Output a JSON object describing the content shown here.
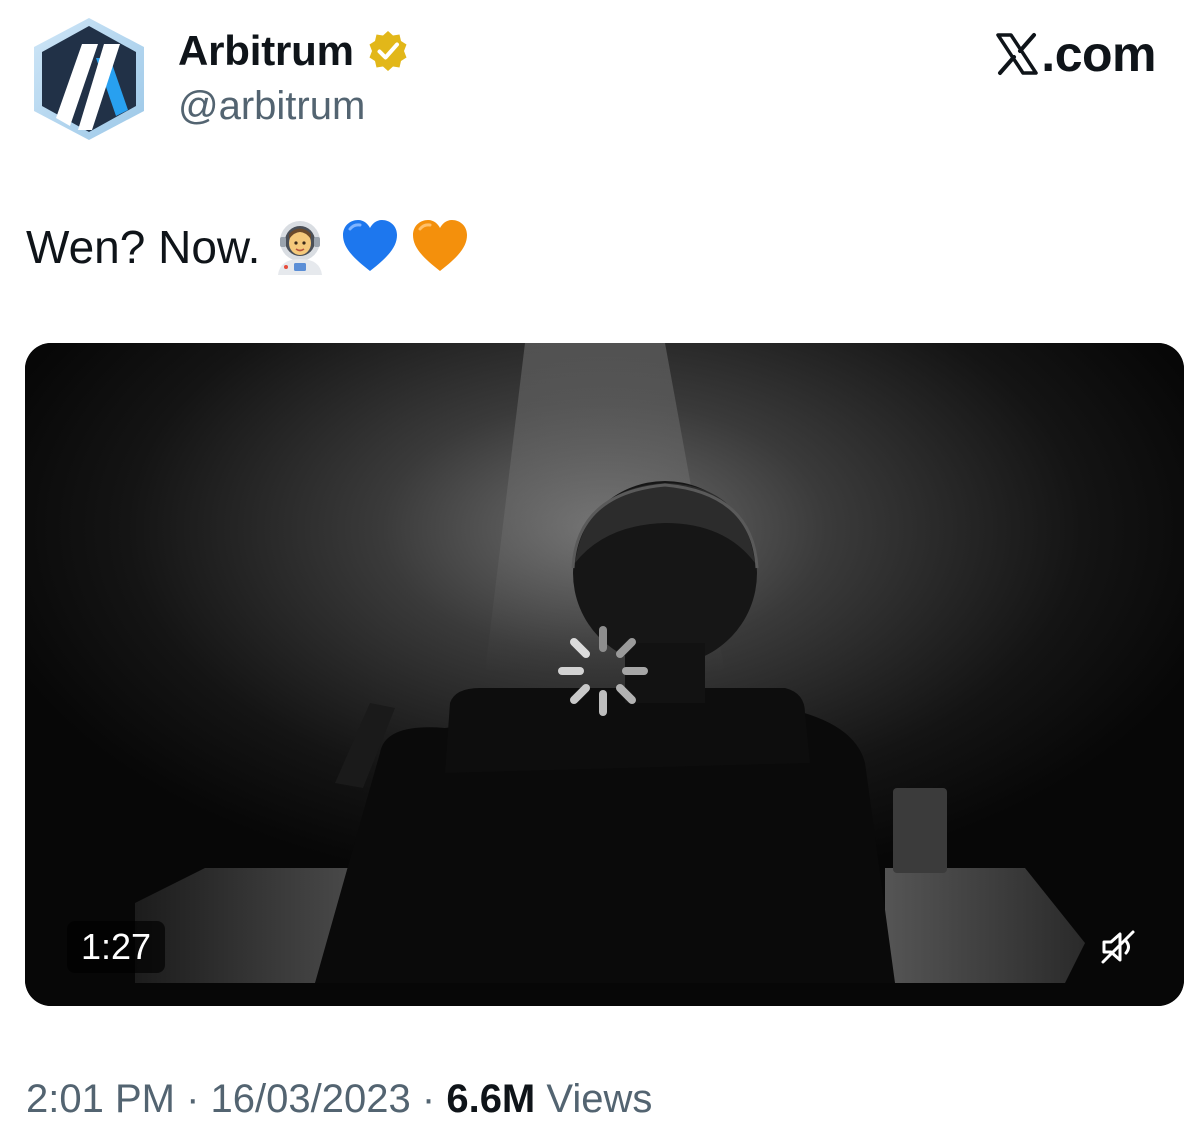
{
  "author": {
    "name": "Arbitrum",
    "handle": "@arbitrum",
    "verified": true,
    "avatar_icon": "arbitrum-logo-icon",
    "badge_icon": "verified-badge-icon"
  },
  "brand": {
    "label": ".com",
    "icon": "x-logo-icon"
  },
  "tweet": {
    "text": "Wen? Now.",
    "emojis": [
      "astronaut-emoji",
      "blue-heart-emoji",
      "orange-heart-emoji"
    ]
  },
  "video": {
    "duration": "1:27",
    "muted": true,
    "loading": true
  },
  "meta": {
    "time": "2:01 PM",
    "separator": "·",
    "date": "16/03/2023",
    "views_count": "6.6M",
    "views_label": "Views"
  },
  "colors": {
    "text_primary": "#0f1419",
    "text_secondary": "#536471",
    "verified_gold": "#e2b719",
    "arbitrum_navy": "#213147",
    "arbitrum_blue": "#28a0f0",
    "heart_blue": "#1d77ee",
    "heart_orange": "#f4900c"
  }
}
